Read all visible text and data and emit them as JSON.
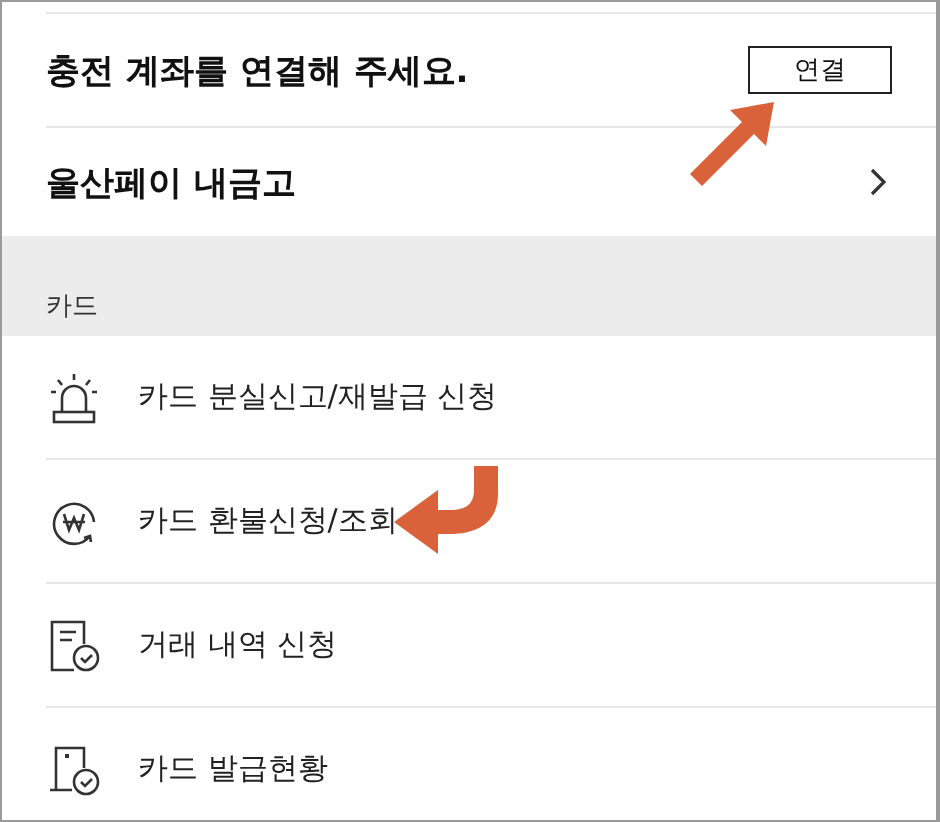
{
  "account_prompt": {
    "text": "충전 계좌를 연결해 주세요.",
    "button": "연결"
  },
  "vault_row": {
    "label": "울산페이 내금고"
  },
  "card_section": {
    "title": "카드",
    "items": [
      {
        "label": "카드 분실신고/재발급 신청"
      },
      {
        "label": "카드 환불신청/조회"
      },
      {
        "label": "거래 내역 신청"
      },
      {
        "label": "카드 발급현황"
      }
    ]
  }
}
